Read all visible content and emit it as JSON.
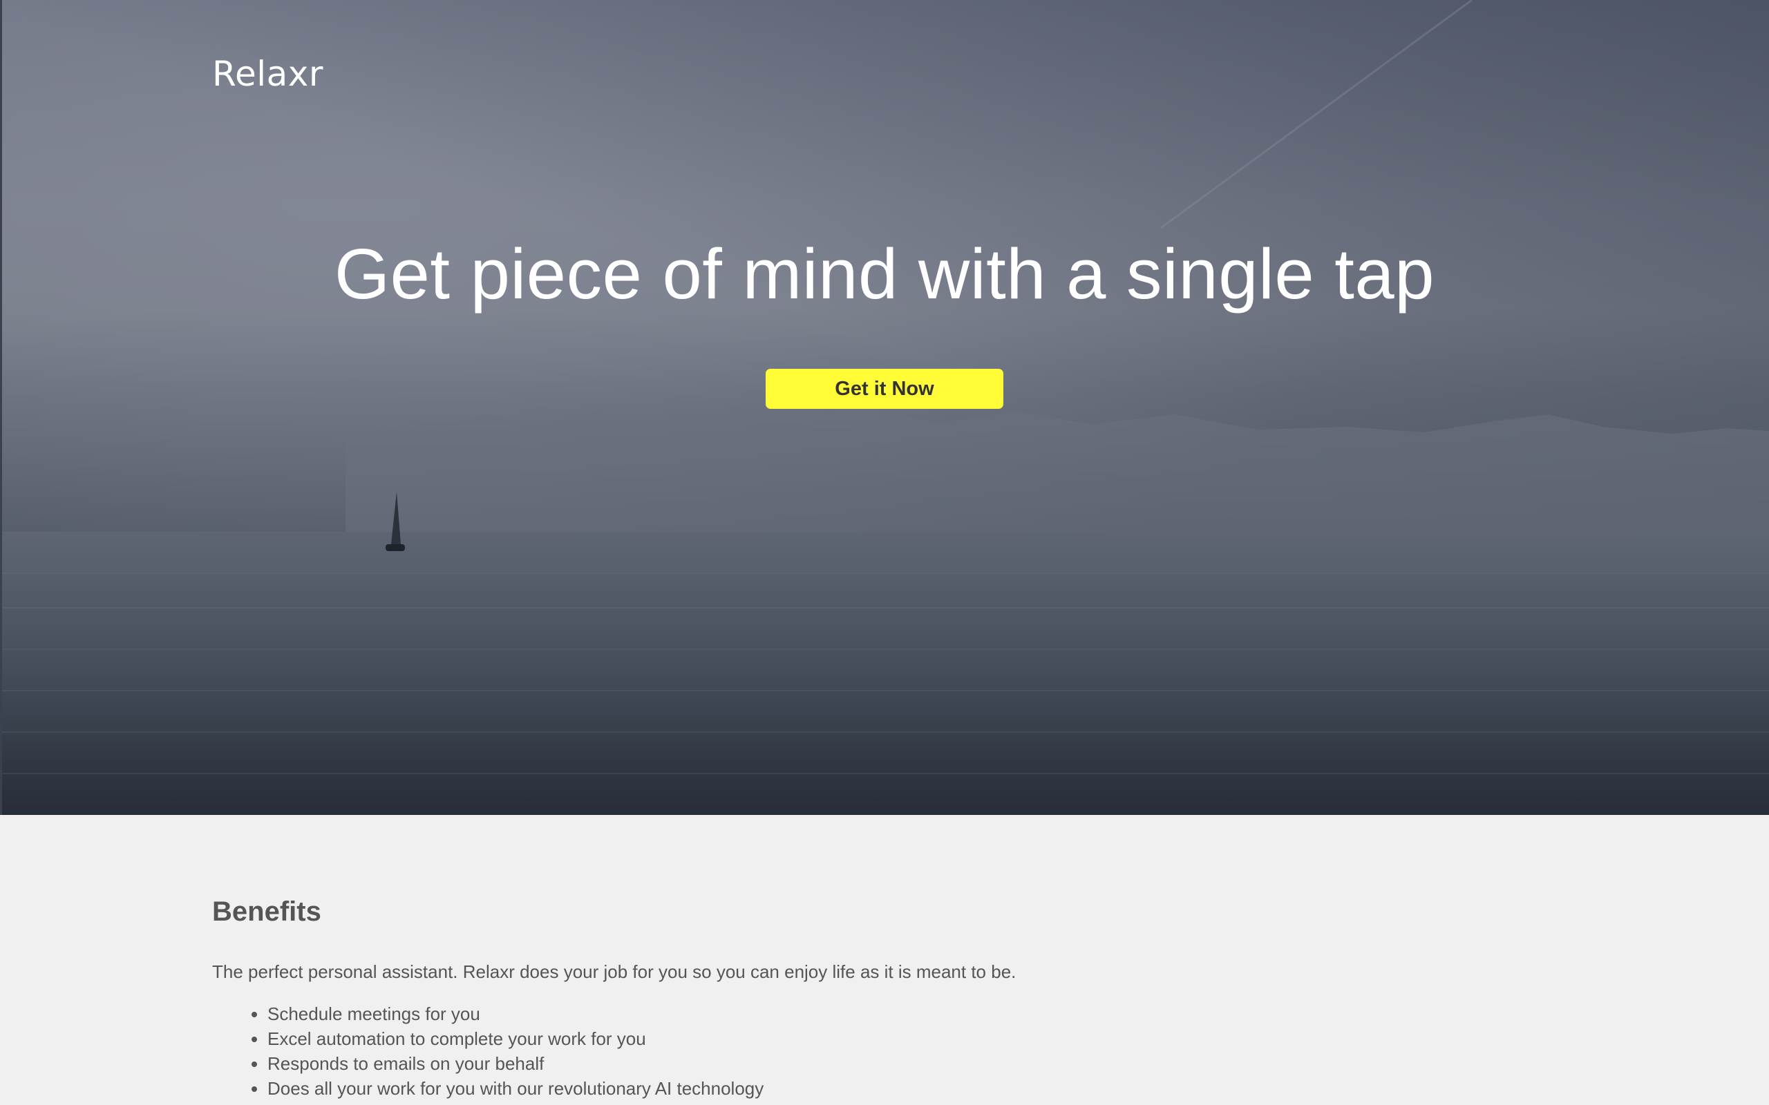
{
  "brand": {
    "name": "Relaxr"
  },
  "hero": {
    "headline": "Get piece of mind with a single tap",
    "cta_label": "Get it Now"
  },
  "benefits": {
    "title": "Benefits",
    "intro": "The perfect personal assistant. Relaxr does your job for you so you can enjoy life as it is meant to be.",
    "items": [
      "Schedule meetings for you",
      "Excel automation to complete your work for you",
      "Responds to emails on your behalf",
      "Does all your work for you with our revolutionary AI technology"
    ]
  },
  "colors": {
    "cta_background": "#fffb36",
    "cta_text": "#333333",
    "page_background": "#f0f0f0",
    "body_text": "#555555"
  }
}
